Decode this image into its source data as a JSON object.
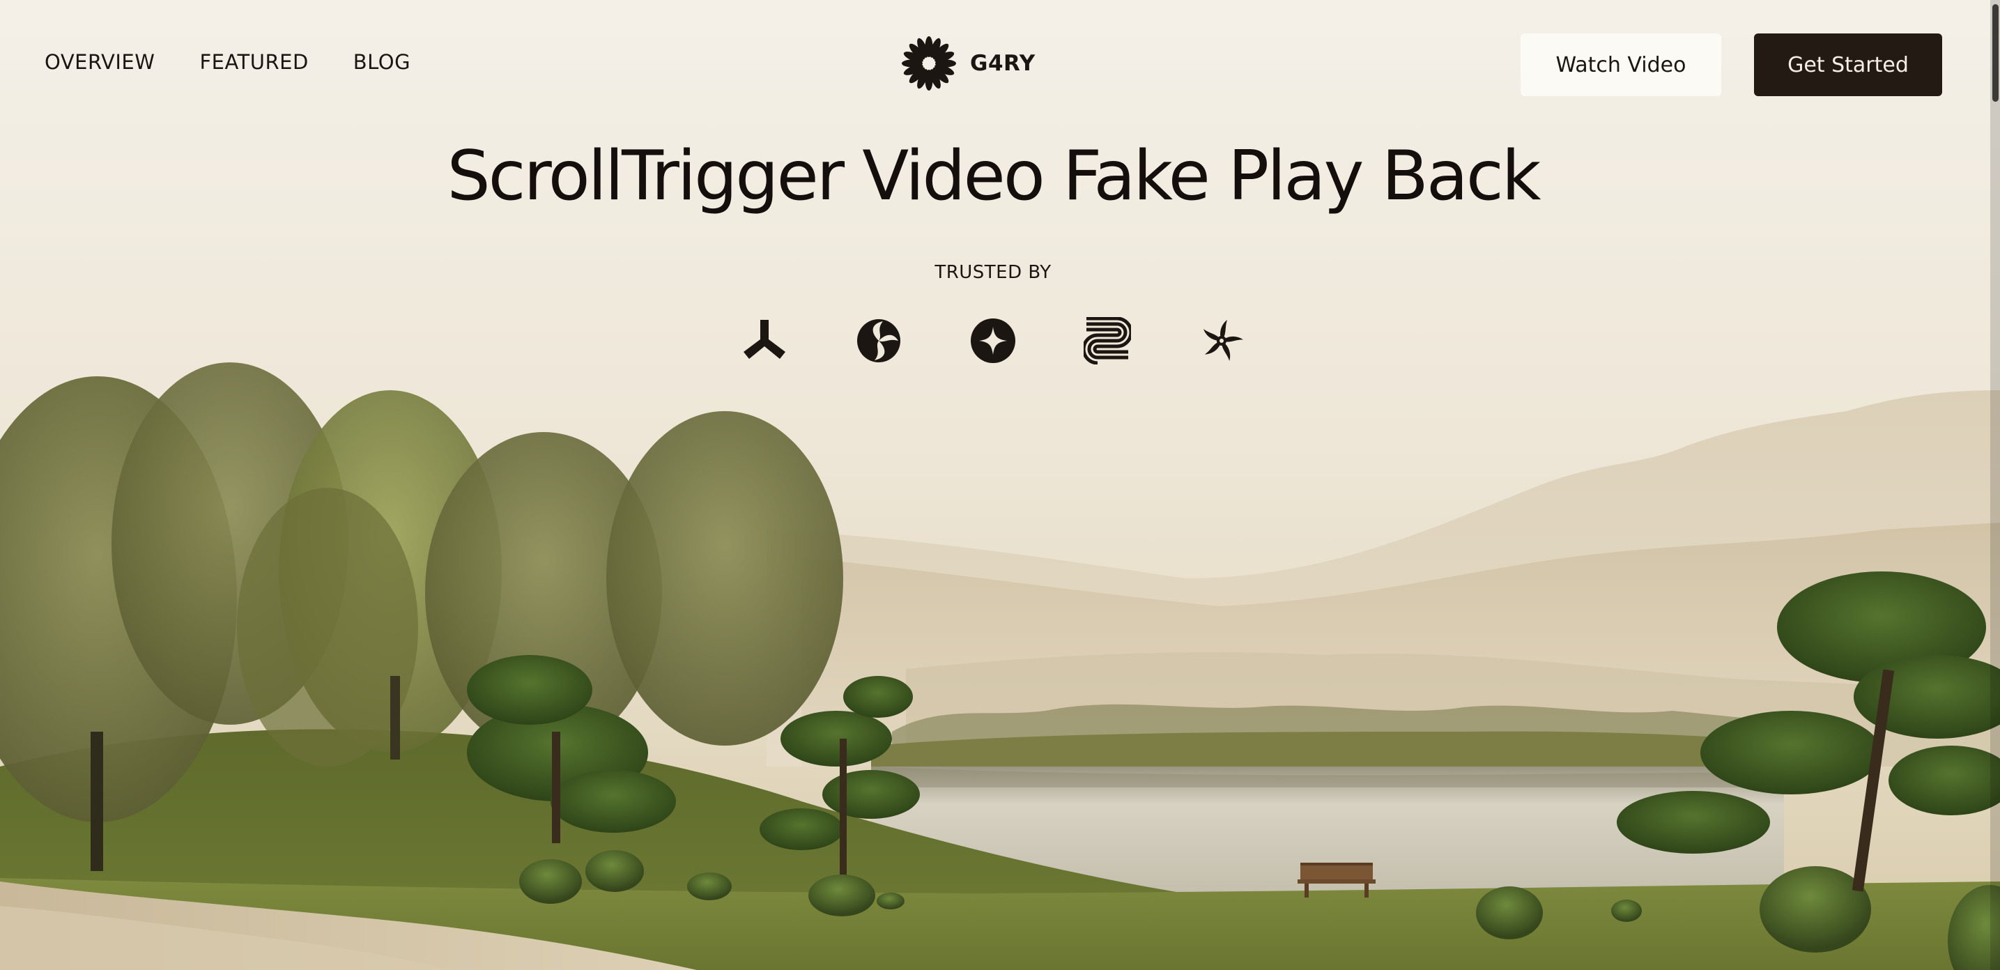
{
  "nav": {
    "links": [
      "OVERVIEW",
      "FEATURED",
      "BLOG"
    ]
  },
  "brand": {
    "name": "G4RY",
    "icon": "sunburst-logo-icon"
  },
  "actions": {
    "watch_label": "Watch Video",
    "start_label": "Get Started"
  },
  "hero": {
    "title": "ScrollTrigger Video Fake Play Back",
    "trusted_label": "TRUSTED BY"
  },
  "partners": [
    {
      "icon": "tripod-logo-icon"
    },
    {
      "icon": "swirl-logo-icon"
    },
    {
      "icon": "star-circle-logo-icon"
    },
    {
      "icon": "stacked-s-logo-icon"
    },
    {
      "icon": "pinwheel-logo-icon"
    }
  ],
  "colors": {
    "text": "#1c1613",
    "button_dark": "#231a14",
    "button_light": "#fcfaf4",
    "sky": "#f3efe6",
    "grass": "#6f7a3a"
  }
}
